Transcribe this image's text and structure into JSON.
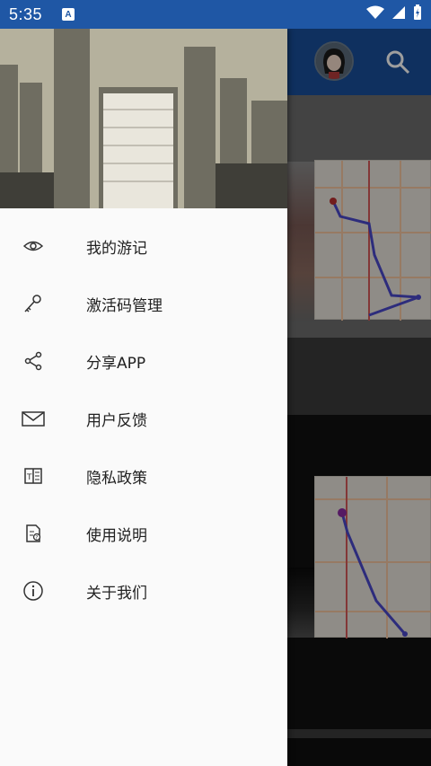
{
  "status_bar": {
    "time": "5:35",
    "notification_badge": "A",
    "icons": [
      "wifi-icon",
      "signal-icon",
      "battery-charging-icon"
    ]
  },
  "toolbar": {
    "icons": [
      "avatar",
      "search-icon"
    ],
    "accent": "#194e9a"
  },
  "drawer": {
    "menu": [
      {
        "icon": "eye-icon",
        "label": "我的游记"
      },
      {
        "icon": "key-icon",
        "label": "激活码管理"
      },
      {
        "icon": "share-icon",
        "label": "分享APP"
      },
      {
        "icon": "mail-icon",
        "label": "用户反馈"
      },
      {
        "icon": "book-icon",
        "label": "隐私政策"
      },
      {
        "icon": "document-help-icon",
        "label": "使用说明"
      },
      {
        "icon": "info-icon",
        "label": "关于我们"
      }
    ]
  },
  "colors": {
    "status_bar": "#1f57a5",
    "toolbar": "#194e9a",
    "drawer_bg": "#fafafa",
    "menu_text": "#222222",
    "icon": "#333333"
  }
}
